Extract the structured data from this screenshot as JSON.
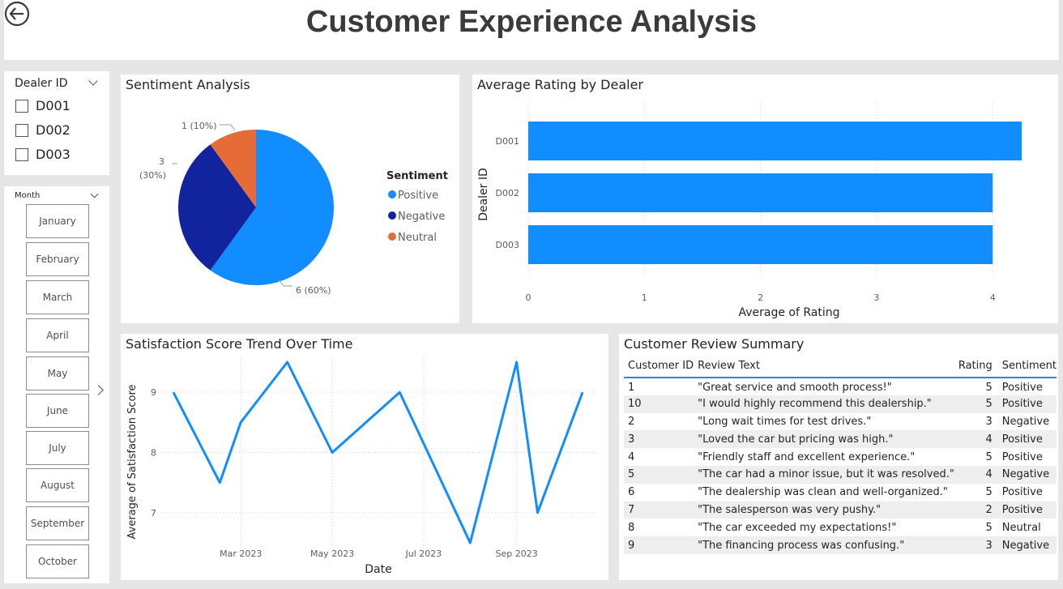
{
  "header": {
    "title": "Customer Experience Analysis",
    "back_icon": "back-arrow-icon"
  },
  "dealer_slicer": {
    "title": "Dealer ID",
    "options": [
      "D001",
      "D002",
      "D003"
    ]
  },
  "month_slicer": {
    "title": "Month",
    "months": [
      "January",
      "February",
      "March",
      "April",
      "May",
      "June",
      "July",
      "August",
      "September",
      "October"
    ]
  },
  "sentiment_chart": {
    "title": "Sentiment Analysis",
    "legend_title": "Sentiment",
    "labels": {
      "positive": "6 (60%)",
      "negative_count": "3",
      "negative_pct": "(30%)",
      "neutral": "1 (10%)"
    }
  },
  "rating_chart": {
    "title": "Average Rating by Dealer"
  },
  "trend_chart": {
    "title": "Satisfaction Score Trend Over Time"
  },
  "review_table": {
    "title": "Customer Review Summary",
    "columns": [
      "Customer ID",
      "Review Text",
      "Rating",
      "Sentiment"
    ],
    "rows": [
      [
        "1",
        "\"Great service and smooth process!\"",
        "5",
        "Positive"
      ],
      [
        "10",
        "\"I would highly recommend this dealership.\"",
        "5",
        "Positive"
      ],
      [
        "2",
        "\"Long wait times for test drives.\"",
        "3",
        "Negative"
      ],
      [
        "3",
        "\"Loved the car but pricing was high.\"",
        "4",
        "Positive"
      ],
      [
        "4",
        "\"Friendly staff and excellent experience.\"",
        "5",
        "Positive"
      ],
      [
        "5",
        "\"The car had a minor issue, but it was resolved.\"",
        "4",
        "Negative"
      ],
      [
        "6",
        "\"The dealership was clean and well-organized.\"",
        "5",
        "Positive"
      ],
      [
        "7",
        "\"The salesperson was very pushy.\"",
        "2",
        "Positive"
      ],
      [
        "8",
        "\"The car exceeded my expectations!\"",
        "5",
        "Neutral"
      ],
      [
        "9",
        "\"The financing process was confusing.\"",
        "3",
        "Negative"
      ]
    ]
  },
  "colors": {
    "positive": "#118dff",
    "negative": "#12239e",
    "neutral": "#e66c37",
    "bar": "#118dff",
    "line": "#118dff"
  },
  "chart_data": [
    {
      "type": "pie",
      "title": "Sentiment Analysis",
      "legend_title": "Sentiment",
      "categories": [
        "Positive",
        "Negative",
        "Neutral"
      ],
      "values": [
        6,
        3,
        1
      ],
      "percentages": [
        60,
        30,
        10
      ],
      "legend_position": "right"
    },
    {
      "type": "bar",
      "orientation": "horizontal",
      "title": "Average Rating by Dealer",
      "categories": [
        "D001",
        "D002",
        "D003"
      ],
      "values": [
        4.25,
        4,
        4
      ],
      "xlabel": "Average of Rating",
      "ylabel": "Dealer ID",
      "xlim": [
        0,
        4.25
      ],
      "xticks": [
        0,
        1,
        2,
        3,
        4
      ],
      "grid": true
    },
    {
      "type": "line",
      "title": "Satisfaction Score Trend Over Time",
      "xlabel": "Date",
      "ylabel": "Average of Satisfaction Score",
      "x": [
        "2023-01-15",
        "2023-02-15",
        "2023-03-01",
        "2023-04-01",
        "2023-05-01",
        "2023-06-15",
        "2023-08-01",
        "2023-09-01",
        "2023-09-15",
        "2023-10-15"
      ],
      "y": [
        9,
        7.5,
        8.5,
        9.5,
        8,
        9,
        6.5,
        9.5,
        7,
        9
      ],
      "yticks": [
        7,
        8,
        9
      ],
      "xticks": [
        "Mar 2023",
        "May 2023",
        "Jul 2023",
        "Sep 2023"
      ],
      "ylim": [
        6.5,
        9.5
      ],
      "grid": true
    }
  ]
}
